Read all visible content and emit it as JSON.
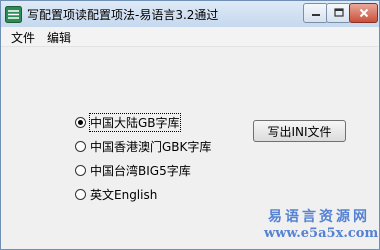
{
  "window": {
    "title": "写配置项读配置项法-易语言3.2通过",
    "colors": {
      "title_bar": "#c5d8ee",
      "close_button": "#c9503b",
      "watermark": "#3b6fcf"
    }
  },
  "menu": {
    "items": [
      {
        "label": "文件"
      },
      {
        "label": "编辑"
      }
    ]
  },
  "radios": [
    {
      "label": "中国大陆GB字库",
      "selected": true
    },
    {
      "label": "中国香港澳门GBK字库",
      "selected": false
    },
    {
      "label": "中国台湾BIG5字库",
      "selected": false
    },
    {
      "label": "英文English",
      "selected": false
    }
  ],
  "write_button": {
    "label": "写出INI文件"
  },
  "watermark": {
    "line1": "易语言资源网",
    "line2": "www.e5a5x.com"
  }
}
